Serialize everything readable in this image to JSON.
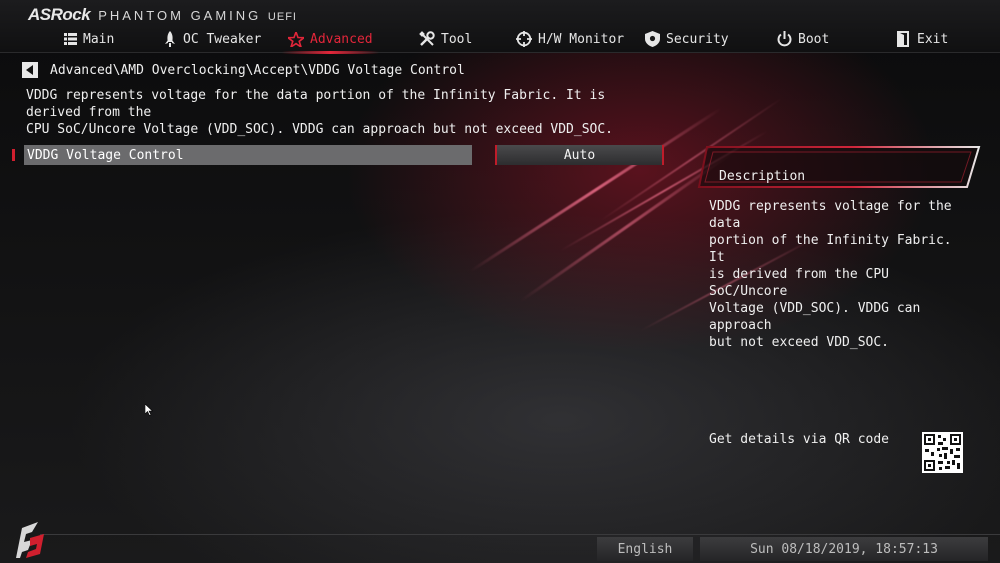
{
  "brand": {
    "logo": "ASRock",
    "subtitle": "PHANTOM GAMING",
    "suffix": "UEFI"
  },
  "tabs": [
    {
      "label": "Main",
      "icon": "list-icon",
      "active": false
    },
    {
      "label": "OC Tweaker",
      "icon": "rocket-icon",
      "active": false
    },
    {
      "label": "Advanced",
      "icon": "star-icon",
      "active": true
    },
    {
      "label": "Tool",
      "icon": "tools-icon",
      "active": false
    },
    {
      "label": "H/W Monitor",
      "icon": "crosshair-icon",
      "active": false
    },
    {
      "label": "Security",
      "icon": "shield-icon",
      "active": false
    },
    {
      "label": "Boot",
      "icon": "power-icon",
      "active": false
    },
    {
      "label": "Exit",
      "icon": "exit-icon",
      "active": false
    }
  ],
  "breadcrumb": "Advanced\\AMD Overclocking\\Accept\\VDDG Voltage Control",
  "intro": {
    "line1": "VDDG represents voltage for the data portion of the Infinity Fabric. It is derived from the",
    "line2": "CPU SoC/Uncore Voltage (VDD_SOC). VDDG can approach but not exceed VDD_SOC."
  },
  "setting": {
    "label": "VDDG Voltage Control",
    "value": "Auto"
  },
  "description": {
    "title": "Description",
    "lines": [
      "VDDG represents voltage for the data",
      "portion of the Infinity Fabric. It",
      "is derived from the CPU SoC/Uncore",
      "Voltage (VDD_SOC). VDDG can approach",
      "but not exceed VDD_SOC."
    ]
  },
  "qr_label": "Get details via QR code",
  "footer": {
    "language": "English",
    "datetime": "Sun 08/18/2019, 18:57:13"
  },
  "colors": {
    "accent": "#e2263a",
    "text": "#efefef",
    "highlight_row": "#6b6b6d"
  }
}
